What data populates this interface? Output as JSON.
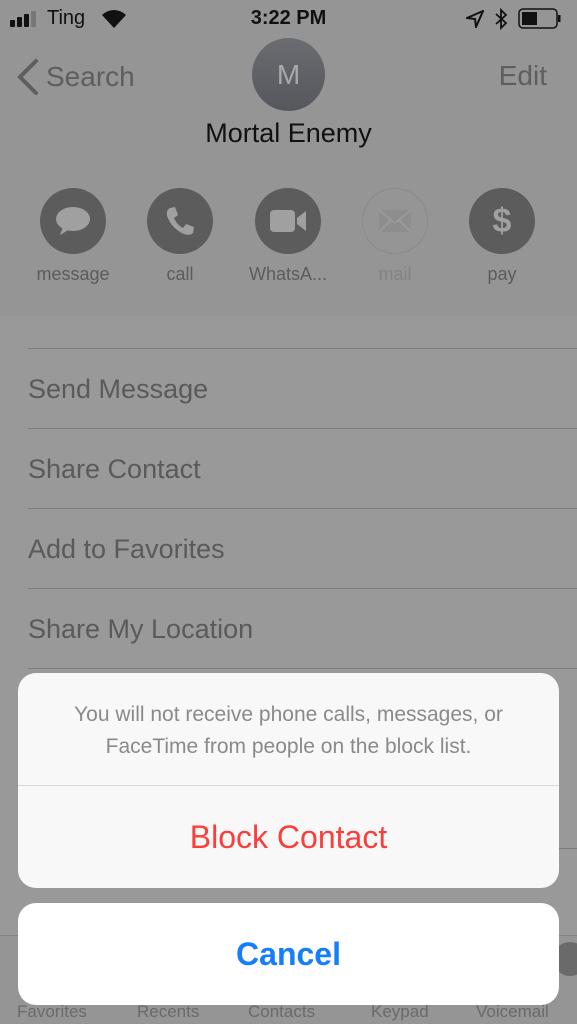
{
  "status_bar": {
    "carrier": "Ting",
    "time": "3:22 PM",
    "icons": [
      "signal-icon",
      "wifi-icon",
      "location-icon",
      "bluetooth-icon",
      "battery-icon"
    ]
  },
  "nav": {
    "back_label": "Search",
    "edit_label": "Edit"
  },
  "contact": {
    "initial": "M",
    "name": "Mortal Enemy"
  },
  "actions": [
    {
      "label": "message",
      "icon": "message-icon",
      "enabled": true
    },
    {
      "label": "call",
      "icon": "phone-icon",
      "enabled": true
    },
    {
      "label": "WhatsA...",
      "icon": "video-icon",
      "enabled": true
    },
    {
      "label": "mail",
      "icon": "mail-icon",
      "enabled": false
    },
    {
      "label": "pay",
      "icon": "dollar-icon",
      "enabled": true
    }
  ],
  "list": [
    "Send Message",
    "Share Contact",
    "Add to Favorites",
    "Share My Location"
  ],
  "tabs": [
    "Favorites",
    "Recents",
    "Contacts",
    "Keypad",
    "Voicemail"
  ],
  "sheet": {
    "message": "You will not receive phone calls, messages, or FaceTime from people on the block list.",
    "block_label": "Block Contact",
    "cancel_label": "Cancel"
  },
  "colors": {
    "destructive": "#fc3d39",
    "accent": "#147efb"
  }
}
